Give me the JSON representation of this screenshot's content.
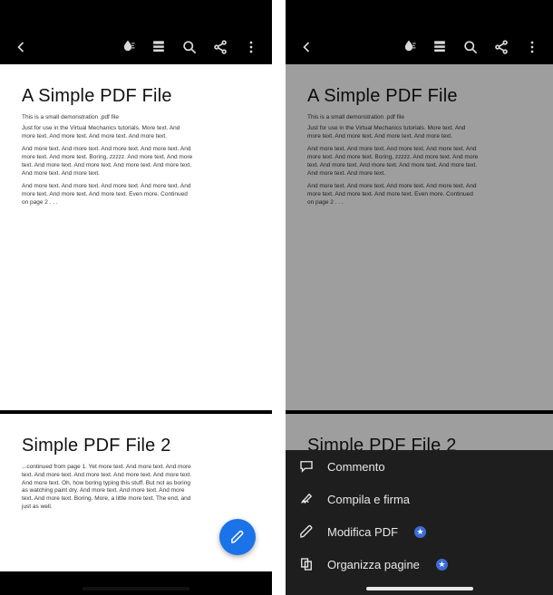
{
  "doc": {
    "page1": {
      "title": "A Simple PDF File",
      "intro": "This is a small demonstration .pdf file",
      "p1": "Just for use in the Virtual Mechanics tutorials. More text. And more text. And more text. And more text. And more text.",
      "p2": "And more text. And more text. And more text. And more text. And more text. And more text. Boring, zzzzz. And more text. And more text. And more text. And more text. And more text. And more text. And more text. And more text.",
      "p3": "And more text. And more text. And more text. And more text. And more text. And more text. And more text. Even more. Continued on page 2 . . ."
    },
    "page2": {
      "title": "Simple PDF File 2",
      "p1": "...continued from page 1. Yet more text. And more text. And more text. And more text. And more text. And more text. And more text. And more text. Oh, how boring typing this stuff. But not as boring as watching paint dry. And more text. And more text. And more text. And more text. Boring. More, a little more text. The end, and just as well."
    }
  },
  "sheet": {
    "comment": "Commento",
    "fill_sign": "Compila e firma",
    "edit_pdf": "Modifica PDF",
    "organize": "Organizza pagine",
    "badge": "★"
  }
}
